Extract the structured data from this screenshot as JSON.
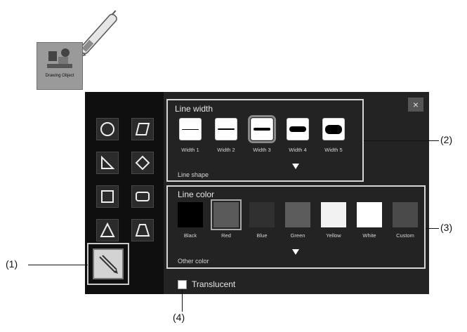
{
  "launcher": {
    "label": "Drawing Object",
    "pen_icon": "pen-icon",
    "icon": "drawing-object-icon"
  },
  "shape_tools": {
    "items": [
      {
        "name": "circle-shape-icon"
      },
      {
        "name": "parallelogram-shape-icon"
      },
      {
        "name": "right-triangle-shape-icon"
      },
      {
        "name": "diamond-shape-icon"
      },
      {
        "name": "square-shape-icon"
      },
      {
        "name": "rounded-rectangle-shape-icon"
      },
      {
        "name": "triangle-shape-icon"
      },
      {
        "name": "trapezoid-shape-icon"
      }
    ],
    "selected_tool_icon": "line-pen-tool-icon"
  },
  "line_width": {
    "title": "Line width",
    "options": [
      "Width 1",
      "Width 2",
      "Width 3",
      "Width 4",
      "Width 5"
    ],
    "selected": "Width 3",
    "footer": "Line shape"
  },
  "line_color": {
    "title": "Line color",
    "options": [
      {
        "label": "Black",
        "hex": "#000000"
      },
      {
        "label": "Red",
        "hex": "#5a5a5a"
      },
      {
        "label": "Blue",
        "hex": "#303030"
      },
      {
        "label": "Green",
        "hex": "#5c5c5c"
      },
      {
        "label": "Yellow",
        "hex": "#f2f2f2"
      },
      {
        "label": "White",
        "hex": "#ffffff"
      },
      {
        "label": "Custom",
        "hex": "#4a4a4a"
      }
    ],
    "selected": "Red",
    "footer": "Other color"
  },
  "translucent": {
    "label": "Translucent",
    "checked": false
  },
  "close_label": "×",
  "callouts": {
    "c1": "(1)",
    "c2": "(2)",
    "c3": "(3)",
    "c4": "(4)"
  }
}
